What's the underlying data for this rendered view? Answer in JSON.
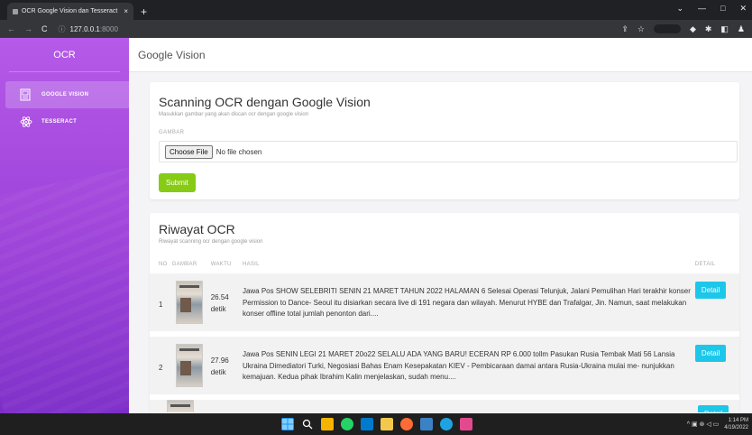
{
  "browser": {
    "tab_title": "OCR Google Vision dan Tesseract",
    "tab_close": "×",
    "new_tab": "+",
    "back": "←",
    "forward": "→",
    "reload": "C",
    "info_icon": "ⓘ",
    "url_host": "127.0.0.1",
    "url_port": ":8000",
    "minimize": "—",
    "maximize": "□",
    "window_close": "✕",
    "chevron": "⌄",
    "share": "⇪",
    "star": "☆",
    "ext_a": "◆",
    "ext_b": "✱",
    "ext_c": "◧",
    "account": "♟"
  },
  "sidebar": {
    "brand": "OCR",
    "items": [
      {
        "label": "GOOGLE VISION",
        "icon": "image-icon",
        "active": true
      },
      {
        "label": "TESSERACT",
        "icon": "atom-icon",
        "active": false
      }
    ]
  },
  "header": {
    "title": "Google Vision"
  },
  "form": {
    "title": "Scanning OCR dengan Google Vision",
    "subtitle": "Masukkan gambar yang akan discan ocr dengan google vision",
    "field_label": "GAMBAR",
    "file_button": "Choose File",
    "file_status": "No file chosen",
    "submit_label": "Submit"
  },
  "history": {
    "title": "Riwayat OCR",
    "subtitle": "Riwayat scanning ocr dengan google vision",
    "columns": [
      "NO",
      "GAMBAR",
      "WAKTU",
      "HASIL",
      "DETAIL"
    ],
    "rows": [
      {
        "no": "1",
        "time": "26.54",
        "time_unit": "detik",
        "result": "Jawa Pos SHOW SELEBRITI SENIN 21 MARET TAHUN 2022 HALAMAN 6 Selesai Operasi Telunjuk, Jalani Pemulihan Hari terakhir konser Permission to Dance- Seoul itu disiarkan secara live di 191 negara dan wilayah. Menurut HYBE dan Trafalgar, Jin. Namun, saat melakukan konser offline total jumlah penonton dari....",
        "button": "Detail"
      },
      {
        "no": "2",
        "time": "27.96",
        "time_unit": "detik",
        "result": "Jawa Pos SENIN LEGI 21 MARET 20o22 SELALU ADA YANG BARU! ECERAN RP 6.000 tollm Pasukan Rusia Tembak Mati 56 Lansia Ukraina Dimediatori Turki, Negosiasi Bahas Enam Kesepakatan KIEV - Pembicaraan damai antara Rusia-Ukraina mulai me- nunjukkan kemajuan. Kedua pihak Ibrahim Kalin menjelaskan, sudah menu....",
        "button": "Detail"
      },
      {
        "button": "Detail"
      }
    ]
  },
  "taskbar": {
    "time": "1:14 PM",
    "date": "4/19/2022",
    "tray": "^ ▣ ⊛ ◁ ▭"
  }
}
